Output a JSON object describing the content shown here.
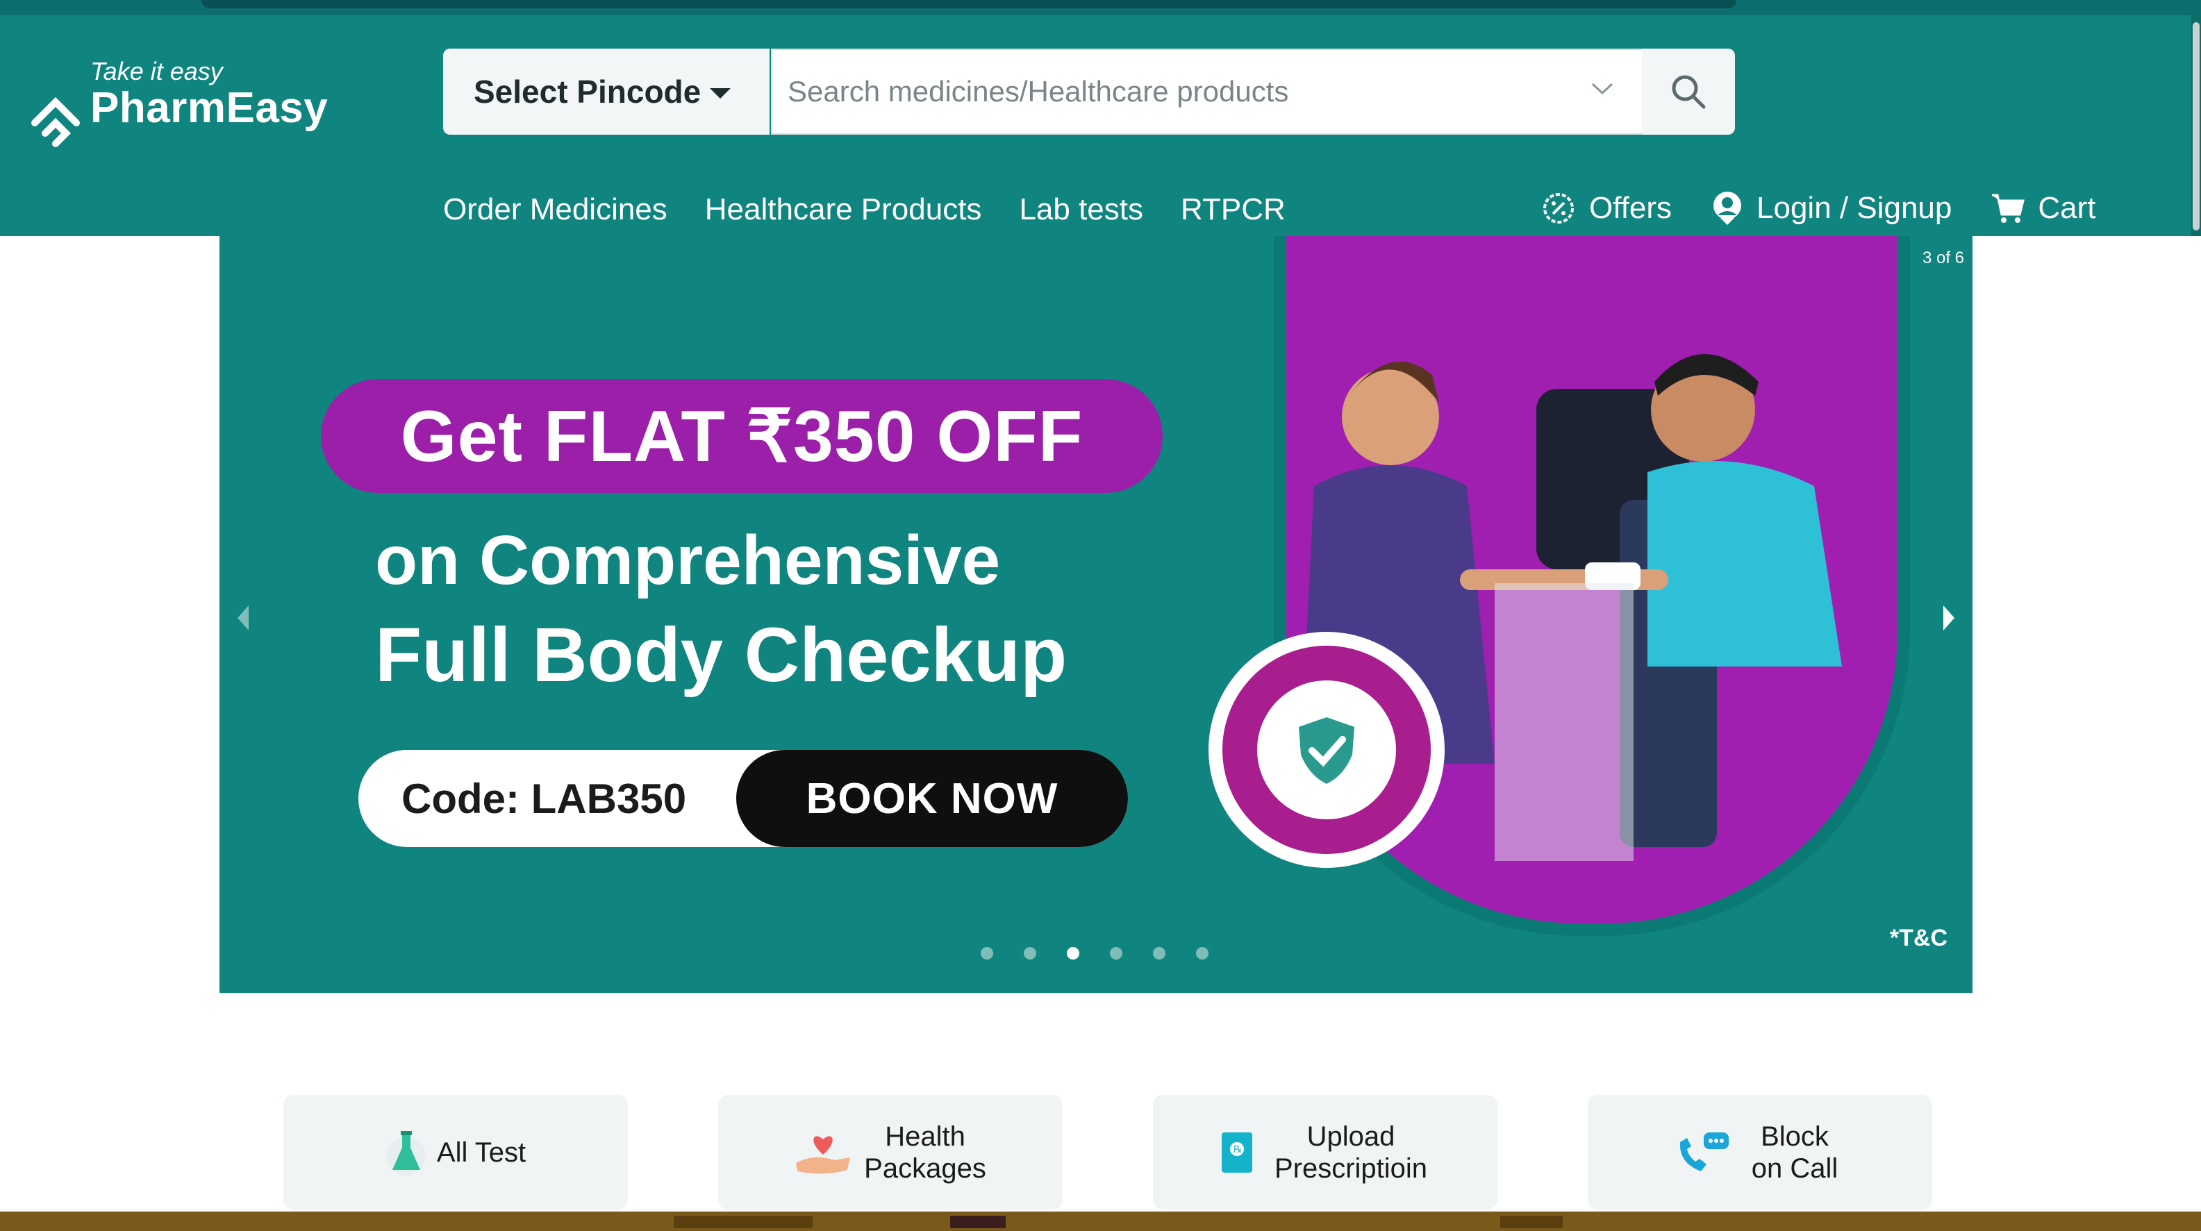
{
  "header": {
    "tagline": "Take it easy",
    "brand": "PharmEasy",
    "pincode_label": "Select Pincode",
    "search_placeholder": "Search medicines/Healthcare products",
    "nav": [
      "Order Medicines",
      "Healthcare Products",
      "Lab tests",
      "RTPCR"
    ],
    "offers_label": "Offers",
    "login_label": "Login / Signup",
    "cart_label": "Cart"
  },
  "carousel": {
    "counter": "3 of 6",
    "headline": "Get FLAT ₹350 OFF",
    "line1": "on Comprehensive",
    "line2": "Full Body Checkup",
    "code": "Code: LAB350",
    "cta": "BOOK NOW",
    "tc": "*T&C",
    "slides_total": 6,
    "active_slide": 3
  },
  "tiles": [
    {
      "label": "All Test",
      "icon": "flask-icon"
    },
    {
      "label": "Health Packages",
      "icon": "heart-hand-icon"
    },
    {
      "label": "Upload Prescriptioin",
      "icon": "prescription-icon"
    },
    {
      "label": "Block on Call",
      "icon": "phone-chat-icon"
    }
  ],
  "colors": {
    "brand_teal": "#10847e",
    "promo_purple": "#9b1fa8",
    "cta_black": "#0f0f0f"
  }
}
